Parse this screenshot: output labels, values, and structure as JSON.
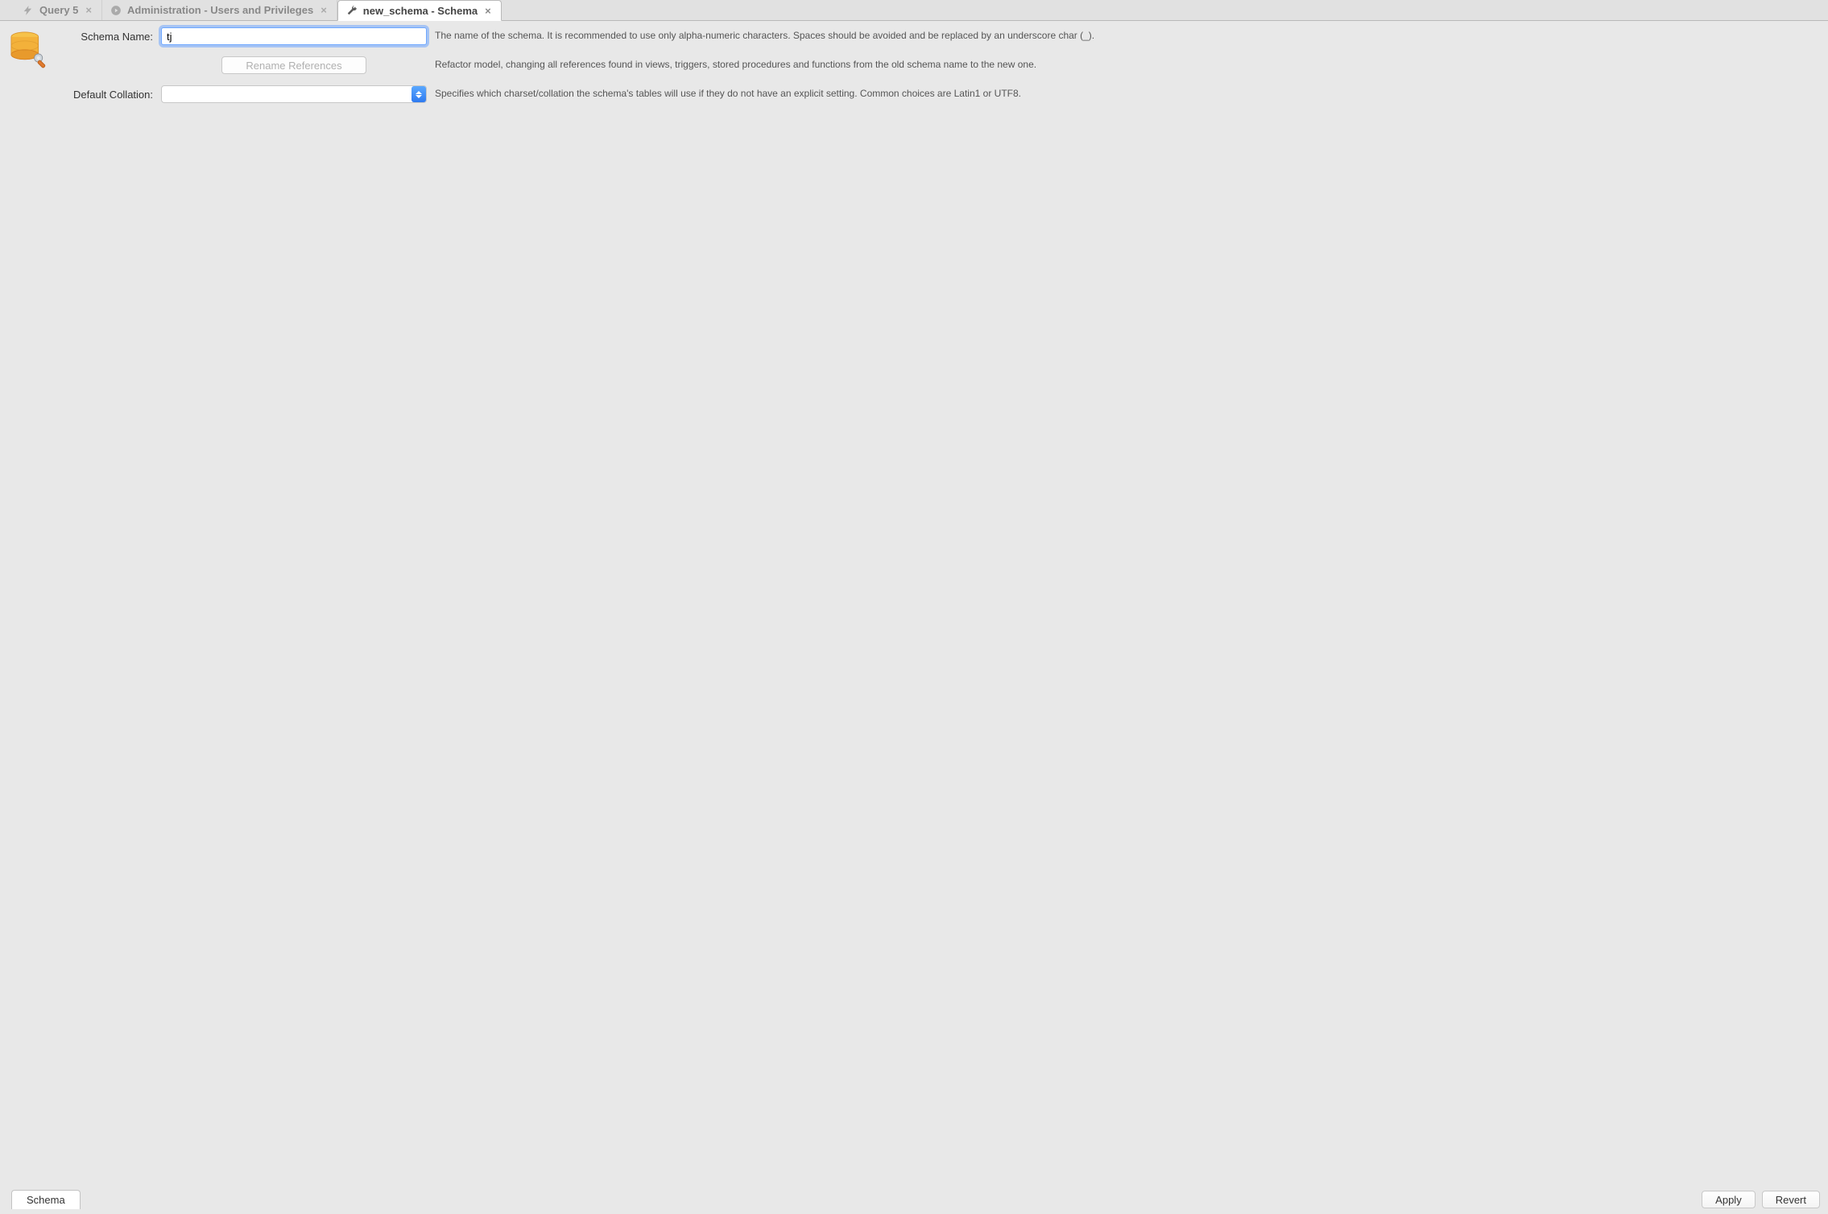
{
  "tabs": [
    {
      "label": "Query 5",
      "icon": "bolt"
    },
    {
      "label": "Administration - Users and Privileges",
      "icon": "play"
    },
    {
      "label": "new_schema - Schema",
      "icon": "wrench",
      "active": true
    }
  ],
  "form": {
    "schema_name_label": "Schema Name:",
    "schema_name_value": "tj",
    "schema_name_help": "The name of the schema. It is recommended to use only alpha-numeric characters. Spaces should be avoided and be replaced by an underscore char (_).",
    "refactor_button": "Rename References",
    "refactor_help": "Refactor model, changing all references found in views, triggers, stored procedures and functions from the old schema name to the new one.",
    "collation_label": "Default Collation:",
    "collation_value": "",
    "collation_help": "Specifies which charset/collation the schema's tables will use if they do not have an explicit setting. Common choices are Latin1 or UTF8."
  },
  "bottom": {
    "left_tabs": {
      "schema": "Schema"
    },
    "actions": {
      "apply": "Apply",
      "revert": "Revert"
    }
  }
}
